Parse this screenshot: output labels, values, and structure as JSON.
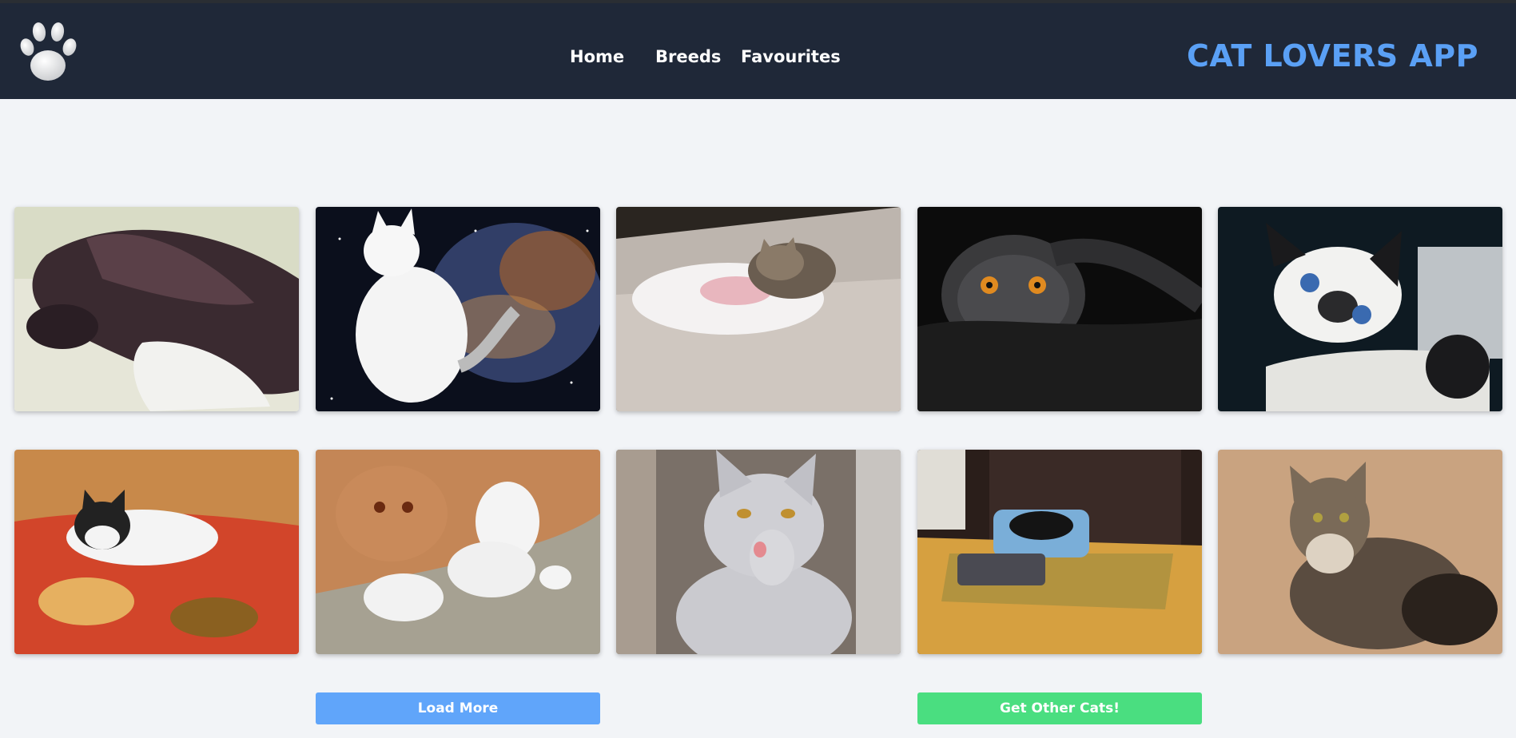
{
  "header": {
    "logo_icon": "paw-icon",
    "nav": [
      {
        "label": "Home"
      },
      {
        "label": "Breeds"
      },
      {
        "label": "Favourites"
      }
    ],
    "app_title": "CAT LOVERS APP",
    "accent_color": "#5aa0f5",
    "background_color": "#1f2838"
  },
  "gallery": {
    "images": [
      {
        "name": "cat-image-sleeping-dark-cat"
      },
      {
        "name": "cat-image-white-cat-space"
      },
      {
        "name": "cat-image-kitten-with-rabbit"
      },
      {
        "name": "cat-image-grey-cat-orange-eyes"
      },
      {
        "name": "cat-image-siamese-blue-eyes"
      },
      {
        "name": "cat-image-kitten-on-pillow"
      },
      {
        "name": "cat-image-persian-with-kittens"
      },
      {
        "name": "cat-image-grey-cat-licking-paw"
      },
      {
        "name": "cat-image-cat-in-blue-bed"
      },
      {
        "name": "cat-image-tabby-longhair"
      }
    ]
  },
  "actions": {
    "load_more_label": "Load More",
    "load_more_color": "#60a5fa",
    "other_cats_label": "Get Other Cats!",
    "other_cats_color": "#4ade80"
  }
}
